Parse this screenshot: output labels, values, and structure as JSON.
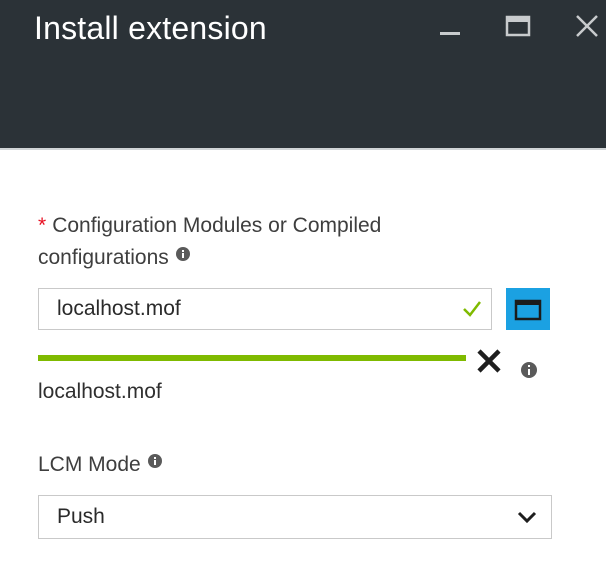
{
  "window": {
    "title": "Install extension",
    "controls": [
      "minimize-icon",
      "maximize-icon",
      "close-icon"
    ]
  },
  "form": {
    "config_label": "Configuration Modules or Compiled configurations",
    "required_mark": "*",
    "config_value": "localhost.mof",
    "uploaded_file": "localhost.mof",
    "upload_progress": 1.0,
    "lcm_label": "LCM Mode",
    "lcm_value": "Push"
  },
  "colors": {
    "header_bg": "#2b3237",
    "accent": "#1ba1e2",
    "success": "#7fba00",
    "required": "#e81123"
  }
}
